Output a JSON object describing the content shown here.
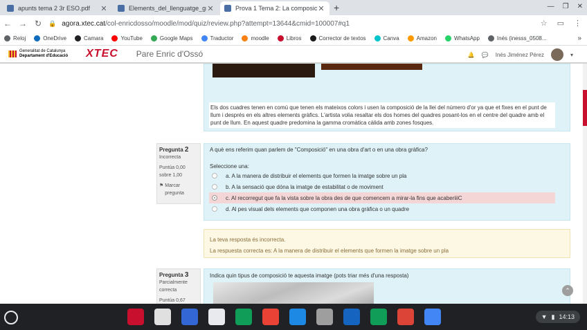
{
  "browser": {
    "tabs": [
      {
        "title": "apunts tema 2 3r ESO.pdf"
      },
      {
        "title": "Elements_del_llenguatge_grafic"
      },
      {
        "title": "Prova 1 Tema 2: La composició"
      }
    ],
    "new_tab": "+",
    "url_host": "agora.xtec.cat",
    "url_path": "/col-enricdosso/moodle/mod/quiz/review.php?attempt=13644&cmid=100007#q1"
  },
  "bookmarks": [
    {
      "label": "Reloj",
      "color": "#5f6368"
    },
    {
      "label": "OneDrive",
      "color": "#0f6cbd"
    },
    {
      "label": "Camara",
      "color": "#202124"
    },
    {
      "label": "YouTube",
      "color": "#ff0000"
    },
    {
      "label": "Google Maps",
      "color": "#34a853"
    },
    {
      "label": "Traductor",
      "color": "#4285f4"
    },
    {
      "label": "moodle",
      "color": "#f98012"
    },
    {
      "label": "Libros",
      "color": "#c8102e"
    },
    {
      "label": "Corrector de textos",
      "color": "#1a1a1a"
    },
    {
      "label": "Canva",
      "color": "#00c4cc"
    },
    {
      "label": "Amazon",
      "color": "#ff9900"
    },
    {
      "label": "WhatsApp",
      "color": "#25d366"
    },
    {
      "label": "Inés (inesss_0508...",
      "color": "#5f6368"
    }
  ],
  "bookmarks_more": "»",
  "site": {
    "gencat_line1": "Generalitat de Catalunya",
    "gencat_line2": "Departament d'Educació",
    "logo": "XTEC",
    "school": "Pare Enric d'Ossó",
    "user": "Inés Jiménez Pérez"
  },
  "q1_feedback": "Els dos cuadres tenen en comú que tenen els mateixos colors i usen la composició de la llei del número d'or ya que et fixes en el punt de llum i després en els altres elements gràfics. L'artista volia resaltar els dos homes del quadres posant-los en el centre del quadre amb el punt de llum. En aquest quadre predomina la gamma cromàtica càlida amb zones fosques.",
  "q2": {
    "label": "Pregunta",
    "number": "2",
    "state": "Incorrecta",
    "grade": "Puntúa 0,00 sobre 1,00",
    "flag": "Marcar pregunta",
    "text": "A què ens referim quan parlem de \"Composició\" en una obra d'art o en una obra gràfica?",
    "prompt": "Seleccione una:",
    "options": [
      "a. A la manera de distribuir el elements que formen la imatge sobre un pla",
      "b. A la sensació que dóna la imatge de estabilitat o de moviment",
      "c. Al recorregut  que fa la vista sobre la obra des de que comencem a mirar-la fins que acaberiiiC",
      "d. Al pes visual dels elements que componen una obra gràfica o un quadre"
    ],
    "feedback_incorrect": "La teva resposta és incorrecta.",
    "feedback_correct": "La respuesta correcta es: A la manera de distribuir el elements que formen la imatge sobre un pla"
  },
  "q3": {
    "label": "Pregunta",
    "number": "3",
    "state": "Parcialmente correcta",
    "grade": "Puntúa 0,67 sobre",
    "text": "Indica quin tipus de composició te aquesta imatge (pots triar més d'una resposta)"
  },
  "shelf": {
    "time": "14:13",
    "apps": [
      "#c8102e",
      "#e0e0e0",
      "#3367d6",
      "#e8eaed",
      "#0f9d58",
      "#ea4335",
      "#1e88e5",
      "#9e9e9e",
      "#1565c0",
      "#0f9d58",
      "#db4437",
      "#4285f4"
    ]
  },
  "colors": {
    "accent": "#c8102e",
    "info_bg": "#def2f8",
    "warning_bg": "#fcf8e3",
    "incorrect_bg": "#f5d6d6"
  }
}
